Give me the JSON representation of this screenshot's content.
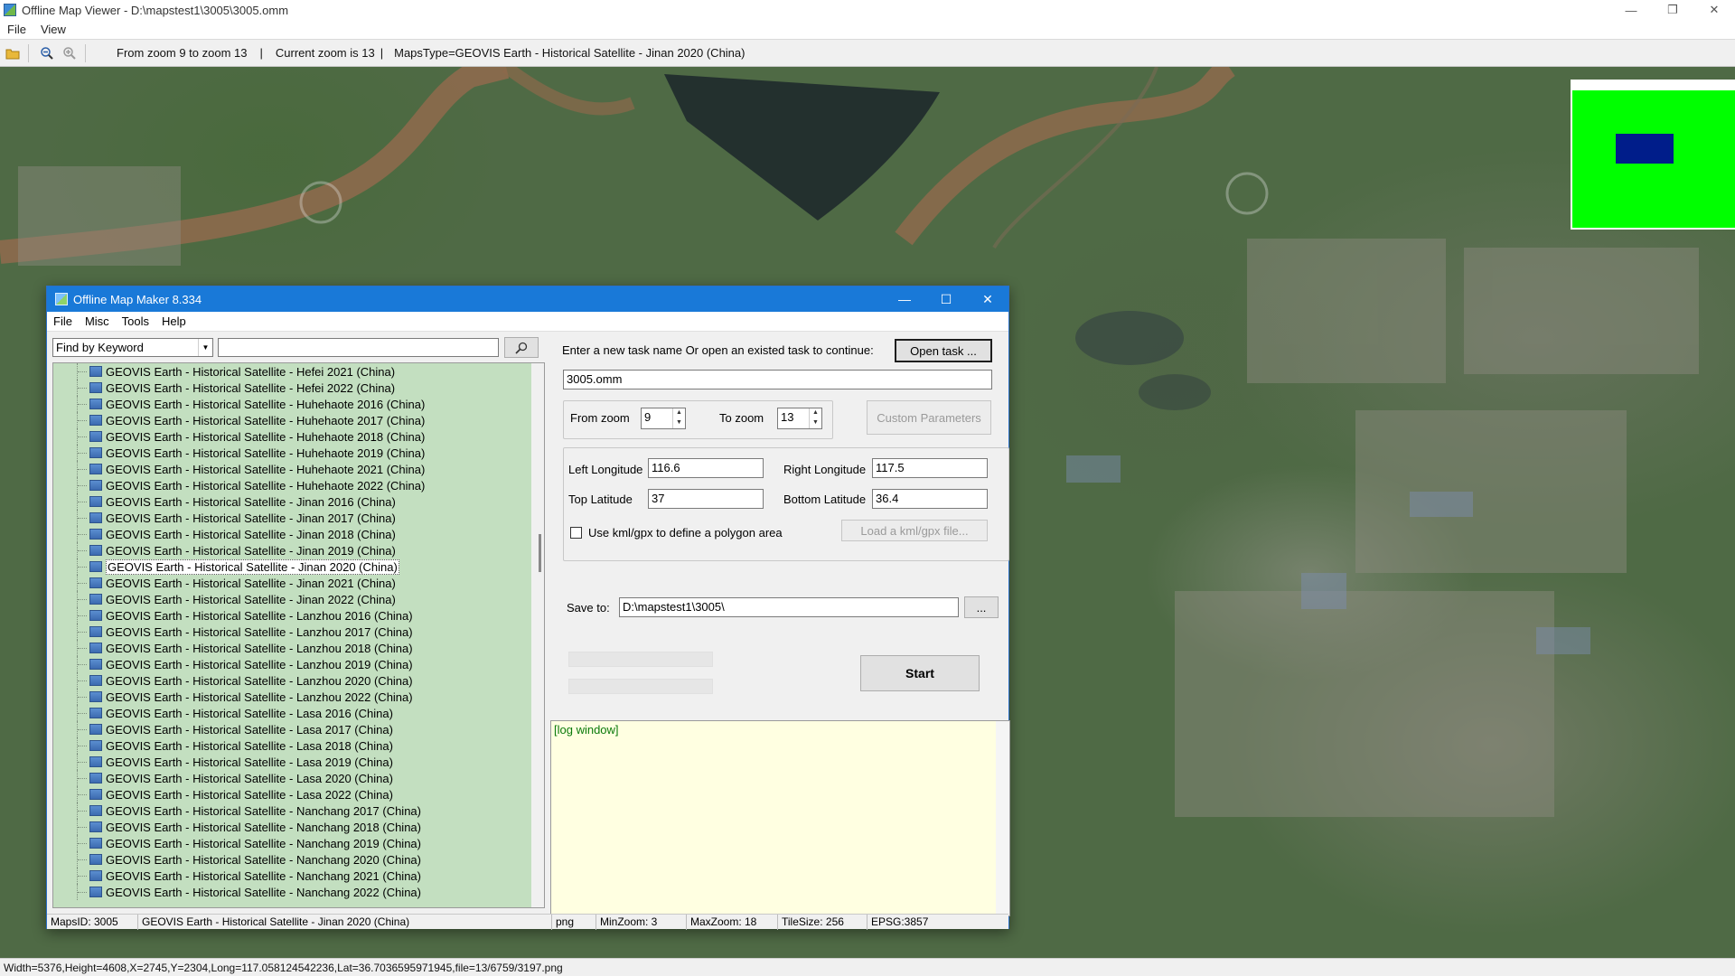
{
  "window": {
    "title": "Offline Map Viewer - D:\\mapstest1\\3005\\3005.omm",
    "controls": [
      "—",
      "❐",
      "✕"
    ]
  },
  "menu": [
    "File",
    "View"
  ],
  "toolbar": {
    "info_zoom_range": "From zoom 9 to zoom 13",
    "info_current_zoom": "Current zoom is 13",
    "info_maps_type": "MapsType=GEOVIS Earth - Historical Satellite - Jinan 2020 (China)"
  },
  "status": "Width=5376,Height=4608,X=2745,Y=2304,Long=117.058124542236,Lat=36.7036595971945,file=13/6759/3197.png",
  "colors": {
    "overview_green": "#00ff00",
    "overview_blue": "#001d8a",
    "tree_bg": "#c3dfc0",
    "dialog_title": "#1979d8",
    "log_bg": "#ffffe1"
  },
  "dialog": {
    "title": "Offline Map Maker 8.334",
    "menu": [
      "File",
      "Misc",
      "Tools",
      "Help"
    ],
    "search": {
      "mode": "Find by Keyword",
      "query": ""
    },
    "tree": [
      "GEOVIS Earth - Historical Satellite - Hefei 2021 (China)",
      "GEOVIS Earth - Historical Satellite - Hefei 2022 (China)",
      "GEOVIS Earth - Historical Satellite - Huhehaote 2016 (China)",
      "GEOVIS Earth - Historical Satellite - Huhehaote 2017 (China)",
      "GEOVIS Earth - Historical Satellite - Huhehaote 2018 (China)",
      "GEOVIS Earth - Historical Satellite - Huhehaote 2019 (China)",
      "GEOVIS Earth - Historical Satellite - Huhehaote 2021 (China)",
      "GEOVIS Earth - Historical Satellite - Huhehaote 2022 (China)",
      "GEOVIS Earth - Historical Satellite - Jinan 2016 (China)",
      "GEOVIS Earth - Historical Satellite - Jinan 2017 (China)",
      "GEOVIS Earth - Historical Satellite - Jinan 2018 (China)",
      "GEOVIS Earth - Historical Satellite - Jinan 2019 (China)",
      "GEOVIS Earth - Historical Satellite - Jinan 2020 (China)",
      "GEOVIS Earth - Historical Satellite - Jinan 2021 (China)",
      "GEOVIS Earth - Historical Satellite - Jinan 2022 (China)",
      "GEOVIS Earth - Historical Satellite - Lanzhou 2016 (China)",
      "GEOVIS Earth - Historical Satellite - Lanzhou 2017 (China)",
      "GEOVIS Earth - Historical Satellite - Lanzhou 2018 (China)",
      "GEOVIS Earth - Historical Satellite - Lanzhou 2019 (China)",
      "GEOVIS Earth - Historical Satellite - Lanzhou 2020 (China)",
      "GEOVIS Earth - Historical Satellite - Lanzhou 2022 (China)",
      "GEOVIS Earth - Historical Satellite - Lasa 2016 (China)",
      "GEOVIS Earth - Historical Satellite - Lasa 2017 (China)",
      "GEOVIS Earth - Historical Satellite - Lasa 2018 (China)",
      "GEOVIS Earth - Historical Satellite - Lasa 2019 (China)",
      "GEOVIS Earth - Historical Satellite - Lasa 2020 (China)",
      "GEOVIS Earth - Historical Satellite - Lasa 2022 (China)",
      "GEOVIS Earth - Historical Satellite - Nanchang 2017 (China)",
      "GEOVIS Earth - Historical Satellite - Nanchang 2018 (China)",
      "GEOVIS Earth - Historical Satellite - Nanchang 2019 (China)",
      "GEOVIS Earth - Historical Satellite - Nanchang 2020 (China)",
      "GEOVIS Earth - Historical Satellite - Nanchang 2021 (China)",
      "GEOVIS Earth - Historical Satellite - Nanchang 2022 (China)"
    ],
    "tree_selected": "GEOVIS Earth - Historical Satellite - Jinan 2020 (China)",
    "task_prompt": "Enter a new task name Or open an existed task to continue:",
    "open_task": "Open task ...",
    "task_name": "3005.omm",
    "from_zoom_label": "From zoom",
    "from_zoom": "9",
    "to_zoom_label": "To zoom",
    "to_zoom": "13",
    "custom_params": "Custom Parameters",
    "left_lon_label": "Left Longitude",
    "left_lon": "116.6",
    "right_lon_label": "Right Longitude",
    "right_lon": "117.5",
    "top_lat_label": "Top Latitude",
    "top_lat": "37",
    "bottom_lat_label": "Bottom Latitude",
    "bottom_lat": "36.4",
    "kml_label": "Use kml/gpx to define a polygon area",
    "kml_checked": false,
    "load_kml": "Load a kml/gpx file...",
    "save_to_label": "Save to:",
    "save_to": "D:\\mapstest1\\3005\\",
    "browse": "...",
    "start": "Start",
    "log": "[log window]",
    "status": {
      "maps_id": "MapsID: 3005",
      "maps_name": "GEOVIS Earth - Historical Satellite - Jinan 2020 (China)",
      "format": "png",
      "min_zoom": "MinZoom: 3",
      "max_zoom": "MaxZoom: 18",
      "tile_size": "TileSize: 256",
      "epsg": "EPSG:3857"
    }
  }
}
